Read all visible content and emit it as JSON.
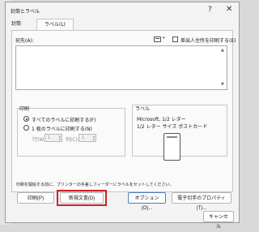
{
  "dialog": {
    "title": "封筒とラベル",
    "help_glyph": "?",
    "close_glyph": "✕"
  },
  "tabs": [
    {
      "label": "封筒",
      "selected": false
    },
    {
      "label": "ラベル(L)",
      "selected": true
    }
  ],
  "address": {
    "label": "宛先(A):",
    "value": "",
    "dropdown_glyph": "▾",
    "use_return_address_label": "差出人住所を印刷する(E)",
    "use_return_address_checked": false
  },
  "print_group": {
    "title": "印刷",
    "options": [
      {
        "label": "すべてのラベルに印刷する(F)",
        "checked": true
      },
      {
        "label": "1 枚のラベルに印刷する(N)",
        "checked": false
      }
    ],
    "row_label": "行(W):",
    "row_value": "1",
    "col_label": "列(C):",
    "col_value": "1"
  },
  "label_group": {
    "title": "ラベル",
    "line1": "Microsoft, 1/2 レター",
    "line2": "1/2 レター サイズ ポストカード"
  },
  "hint_text": "印刷を開始する前に、プリンターの手差しフィーダーにラベルをセットしてください。",
  "buttons": {
    "print": "印刷(P)",
    "new_document": "新規文書(D)",
    "options": "オプション(O)...",
    "postage": "電子切手のプロパティ(T)...",
    "cancel": "キャンセル"
  },
  "colors": {
    "highlight": "#d0212b",
    "default_button_border": "#4a7fc1"
  }
}
